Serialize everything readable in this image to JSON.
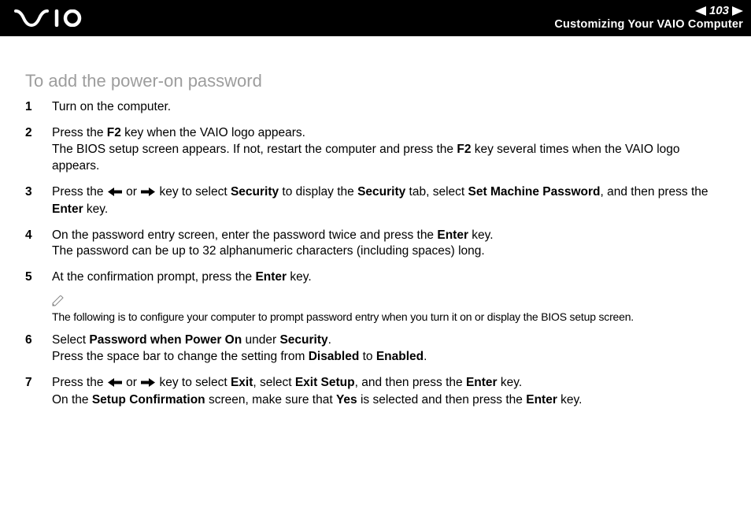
{
  "header": {
    "page_number": "103",
    "breadcrumb": "Customizing Your VAIO Computer"
  },
  "section_title": "To add the power-on password",
  "steps": [
    {
      "n": "1",
      "segments": [
        {
          "t": "Turn on the computer."
        }
      ]
    },
    {
      "n": "2",
      "segments": [
        {
          "t": "Press the "
        },
        {
          "t": "F2",
          "b": true
        },
        {
          "t": " key when the VAIO logo appears."
        },
        {
          "br": true
        },
        {
          "t": "The BIOS setup screen appears. If not, restart the computer and press the "
        },
        {
          "t": "F2",
          "b": true
        },
        {
          "t": " key several times when the VAIO logo appears."
        }
      ]
    },
    {
      "n": "3",
      "segments": [
        {
          "t": "Press the "
        },
        {
          "arrow": "left"
        },
        {
          "t": " or "
        },
        {
          "arrow": "right"
        },
        {
          "t": " key to select "
        },
        {
          "t": "Security",
          "b": true
        },
        {
          "t": " to display the "
        },
        {
          "t": "Security",
          "b": true
        },
        {
          "t": " tab, select "
        },
        {
          "t": "Set Machine Password",
          "b": true
        },
        {
          "t": ", and then press the "
        },
        {
          "t": "Enter",
          "b": true
        },
        {
          "t": " key."
        }
      ]
    },
    {
      "n": "4",
      "segments": [
        {
          "t": "On the password entry screen, enter the password twice and press the "
        },
        {
          "t": "Enter",
          "b": true
        },
        {
          "t": " key."
        },
        {
          "br": true
        },
        {
          "t": "The password can be up to 32 alphanumeric characters (including spaces) long."
        }
      ]
    },
    {
      "n": "5",
      "segments": [
        {
          "t": "At the confirmation prompt, press the "
        },
        {
          "t": "Enter",
          "b": true
        },
        {
          "t": " key."
        }
      ]
    }
  ],
  "note": {
    "icon": "✍",
    "text": "The following is to configure your computer to prompt password entry when you turn it on or display the BIOS setup screen."
  },
  "steps2": [
    {
      "n": "6",
      "segments": [
        {
          "t": "Select "
        },
        {
          "t": "Password when Power On",
          "b": true
        },
        {
          "t": " under "
        },
        {
          "t": "Security",
          "b": true
        },
        {
          "t": "."
        },
        {
          "br": true
        },
        {
          "t": "Press the space bar to change the setting from "
        },
        {
          "t": "Disabled",
          "b": true
        },
        {
          "t": " to "
        },
        {
          "t": "Enabled",
          "b": true
        },
        {
          "t": "."
        }
      ]
    },
    {
      "n": "7",
      "segments": [
        {
          "t": "Press the "
        },
        {
          "arrow": "left"
        },
        {
          "t": " or "
        },
        {
          "arrow": "right"
        },
        {
          "t": " key to select "
        },
        {
          "t": "Exit",
          "b": true
        },
        {
          "t": ", select "
        },
        {
          "t": "Exit Setup",
          "b": true
        },
        {
          "t": ", and then press the "
        },
        {
          "t": "Enter",
          "b": true
        },
        {
          "t": " key."
        },
        {
          "br": true
        },
        {
          "t": "On the "
        },
        {
          "t": "Setup Confirmation",
          "b": true
        },
        {
          "t": " screen, make sure that "
        },
        {
          "t": "Yes",
          "b": true
        },
        {
          "t": " is selected and then press the "
        },
        {
          "t": "Enter",
          "b": true
        },
        {
          "t": " key."
        }
      ]
    }
  ]
}
